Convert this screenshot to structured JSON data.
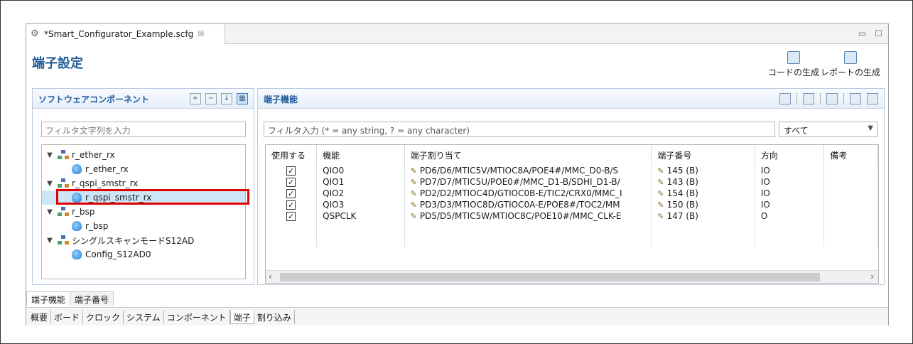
{
  "editor": {
    "tab_title": "*Smart_Configurator_Example.scfg",
    "close_glyph": "☒"
  },
  "page": {
    "title": "端子設定",
    "gen_code_label": "コードの生成",
    "gen_report_label": "レポートの生成"
  },
  "left": {
    "title": "ソフトウェアコンポーネント",
    "filter_placeholder": "フィルタ文字列を入力",
    "tree": [
      {
        "label": "r_ether_rx",
        "level": 0,
        "expanded": true
      },
      {
        "label": "r_ether_rx",
        "level": 1
      },
      {
        "label": "r_qspi_smstr_rx",
        "level": 0,
        "expanded": true
      },
      {
        "label": "r_qspi_smstr_rx",
        "level": 1,
        "selected": true
      },
      {
        "label": "r_bsp",
        "level": 0,
        "expanded": true
      },
      {
        "label": "r_bsp",
        "level": 1
      },
      {
        "label": "シングルスキャンモードS12AD",
        "level": 0,
        "expanded": true
      },
      {
        "label": "Config_S12AD0",
        "level": 1
      }
    ]
  },
  "right": {
    "title": "端子機能",
    "filter_placeholder": "フィルタ入力 (* = any string, ? = any character)",
    "filter_select": "すべて",
    "columns": [
      "使用する",
      "機能",
      "端子割り当て",
      "端子番号",
      "方向",
      "備考"
    ],
    "rows": [
      {
        "used": true,
        "func": "QIO0",
        "assign": "PD6/D6/MTIC5V/MTIOC8A/POE4#/MMC_D0-B/S",
        "pin": "145 (B)",
        "dir": "IO",
        "note": ""
      },
      {
        "used": true,
        "func": "QIO1",
        "assign": "PD7/D7/MTIC5U/POE0#/MMC_D1-B/SDHI_D1-B/",
        "pin": "143 (B)",
        "dir": "IO",
        "note": ""
      },
      {
        "used": true,
        "func": "QIO2",
        "assign": "PD2/D2/MTIOC4D/GTIOC0B-E/TIC2/CRX0/MMC_I",
        "pin": "154 (B)",
        "dir": "IO",
        "note": ""
      },
      {
        "used": true,
        "func": "QIO3",
        "assign": "PD3/D3/MTIOC8D/GTIOC0A-E/POE8#/TOC2/MM",
        "pin": "150 (B)",
        "dir": "IO",
        "note": ""
      },
      {
        "used": true,
        "func": "QSPCLK",
        "assign": "PD5/D5/MTIC5W/MTIOC8C/POE10#/MMC_CLK-E",
        "pin": "147 (B)",
        "dir": "O",
        "note": ""
      }
    ]
  },
  "subtabs": [
    "端子機能",
    "端子番号"
  ],
  "bottom_tabs": [
    "概要",
    "ボード",
    "クロック",
    "システム",
    "コンポーネント",
    "端子",
    "割り込み"
  ],
  "colors": {
    "accent": "#1f5b99",
    "highlight": "#e00000",
    "selection": "#cde6f7"
  }
}
